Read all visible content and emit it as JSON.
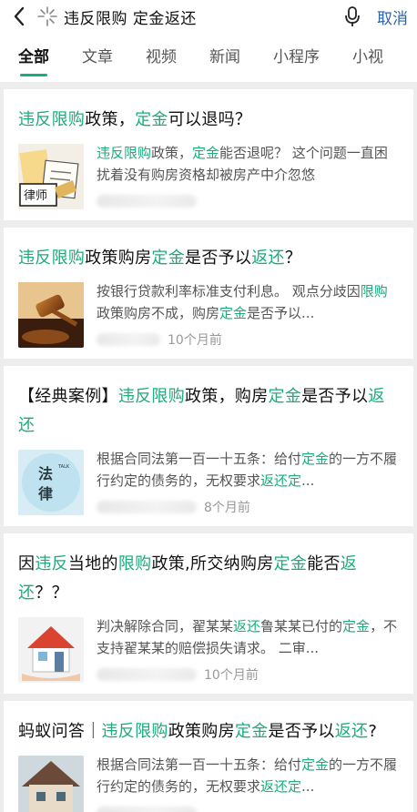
{
  "search": {
    "query": "违反限购 定金返还",
    "cancel_label": "取消"
  },
  "tabs": [
    "全部",
    "文章",
    "视频",
    "新闻",
    "小程序",
    "小视"
  ],
  "colors": {
    "accent": "#1aad7a",
    "link": "#2a64b0"
  },
  "results": [
    {
      "title": [
        [
          "违反限购",
          true
        ],
        [
          "政策，",
          false
        ],
        [
          "定金",
          true
        ],
        [
          "可以退吗？",
          false
        ]
      ],
      "snippet": [
        [
          "违反限购",
          true
        ],
        [
          "政策，",
          false
        ],
        [
          "定金",
          true
        ],
        [
          "能否退呢？ 这个问题一直困扰着没有购房资格却被房产中介忽悠",
          false
        ]
      ],
      "time": "",
      "thumb": "lawyer-image"
    },
    {
      "title": [
        [
          "违反限购",
          true
        ],
        [
          "政策购房",
          false
        ],
        [
          "定金",
          true
        ],
        [
          "是否予以",
          false
        ],
        [
          "返还",
          true
        ],
        [
          "？",
          false
        ]
      ],
      "snippet": [
        [
          "按银行贷款利率标准支付利息。 观点分歧因",
          false
        ],
        [
          "限购",
          true
        ],
        [
          "政策购房不成，购房",
          false
        ],
        [
          "定金",
          true
        ],
        [
          "是否予以...",
          false
        ]
      ],
      "time": "10个月前",
      "thumb": "gavel-image"
    },
    {
      "title": [
        [
          "【经典案例】",
          false
        ],
        [
          "违反限购",
          true
        ],
        [
          "政策，购房",
          false
        ],
        [
          "定金",
          true
        ],
        [
          "是否予以",
          false
        ],
        [
          "返还",
          true
        ]
      ],
      "snippet": [
        [
          "根据合同法第一百一十五条：给付",
          false
        ],
        [
          "定金",
          true
        ],
        [
          "的一方不履行约定的债务的，无权要求",
          false
        ],
        [
          "返还定",
          true
        ],
        [
          "...",
          false
        ]
      ],
      "time": "8个月前",
      "thumb": "law-logo-image"
    },
    {
      "title": [
        [
          "因",
          false
        ],
        [
          "违反",
          true
        ],
        [
          "当地的",
          false
        ],
        [
          "限购",
          true
        ],
        [
          "政策,所交纳购房",
          false
        ],
        [
          "定金",
          true
        ],
        [
          "能否",
          false
        ],
        [
          "返还",
          true
        ],
        [
          "？？",
          false
        ]
      ],
      "snippet": [
        [
          "判决解除合同，翟某某",
          false
        ],
        [
          "返还",
          true
        ],
        [
          "鲁某某已付的",
          false
        ],
        [
          "定金",
          true
        ],
        [
          "，不支持翟某某的赔偿损失请求。 二审...",
          false
        ]
      ],
      "time": "10个月前",
      "thumb": "house-hands-image"
    },
    {
      "title": [
        [
          "蚂蚁问答｜",
          false
        ],
        [
          "违反限购",
          true
        ],
        [
          "政策购房",
          false
        ],
        [
          "定金",
          true
        ],
        [
          "是否予以",
          false
        ],
        [
          "返还",
          true
        ],
        [
          "?",
          false
        ]
      ],
      "snippet": [
        [
          "根据合同法第一百一十五条：给付",
          false
        ],
        [
          "定金",
          true
        ],
        [
          "的一方不履行约定的债务的，无权要求",
          false
        ],
        [
          "返还定",
          true
        ],
        [
          "...",
          false
        ]
      ],
      "time": "",
      "thumb": "house-image"
    }
  ]
}
